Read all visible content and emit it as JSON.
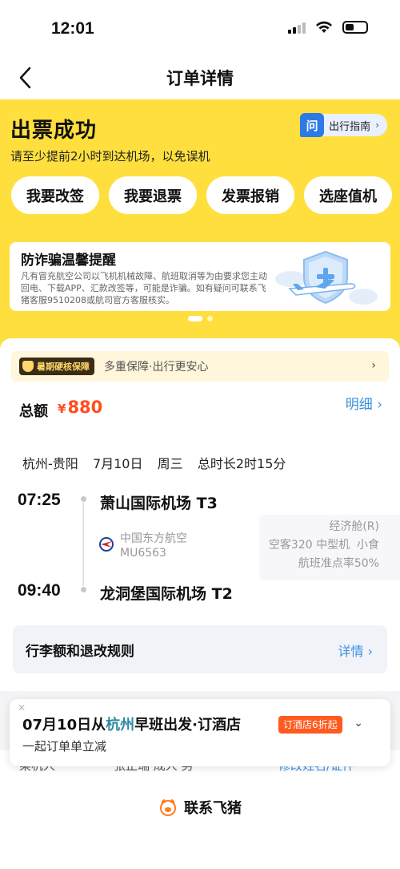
{
  "status": {
    "time": "12:01"
  },
  "nav": {
    "title": "订单详情"
  },
  "ticket": {
    "title": "出票成功",
    "subtitle": "请至少提前2小时到达机场，以免误机",
    "guide_badge": "问",
    "guide_label": "出行指南",
    "actions": [
      "我要改签",
      "我要退票",
      "发票报销",
      "选座值机"
    ]
  },
  "notice": {
    "title": "防诈骗温馨提醒",
    "text": "凡有冒充航空公司以飞机机械故障、航班取消等为由要求您主动回电、下载APP、汇款改签等，可能是诈骗。如有疑问可联系飞猪客服9510208或航司官方客服核实。"
  },
  "protect": {
    "tag": "暑期硬核保障",
    "text": "多重保障·出行更安心"
  },
  "total": {
    "label": "总额",
    "currency": "¥",
    "amount": "880",
    "detail_link": "明细"
  },
  "flight": {
    "route_summary": "杭州-贵阳  7月10日  周三  总时长2时15分",
    "dep_time": "07:25",
    "dep_airport": "萧山国际机场 T3",
    "arr_time": "09:40",
    "arr_airport": "龙洞堡国际机场 T2",
    "airline": "中国东方航空",
    "flight_no": "MU6563",
    "cabin": "经济舱(R)",
    "aircraft": "空客320 中型机  小食",
    "on_time": "航班准点率50%"
  },
  "rules": {
    "label": "行李额和退改规则",
    "link": "详情"
  },
  "passenger_peek": {
    "label": "乘机人",
    "name": "张正瑞 成人 男",
    "action": "修改姓名/证件"
  },
  "hotel": {
    "title_date": "07月10日从",
    "title_city": "杭州",
    "title_rest": "早班出发·订酒店",
    "badge": "订酒店6折起",
    "subtitle": "一起订单单立减"
  },
  "contact": {
    "label": "联系飞猪"
  },
  "colors": {
    "header_yellow": "#ffdf3e",
    "price_orange": "#ff4d1f",
    "link_blue": "#3b8fe0"
  }
}
